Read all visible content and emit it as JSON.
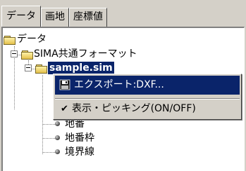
{
  "tabs": [
    {
      "label": "データ",
      "active": true
    },
    {
      "label": "画地",
      "active": false
    },
    {
      "label": "座標値",
      "active": false
    }
  ],
  "tree": {
    "root": {
      "label": "データ",
      "icon": "folder-icon"
    },
    "group": {
      "label": "SIMA共通フォーマット",
      "icon": "folder-icon"
    },
    "selected_item": {
      "label": "sample.sim",
      "icon": "folder-icon"
    },
    "children": [
      {
        "label": "地番",
        "icon": "bullet-icon"
      },
      {
        "label": "地番枠",
        "icon": "bullet-icon"
      },
      {
        "label": "境界線",
        "icon": "bullet-icon"
      }
    ]
  },
  "context_menu": {
    "items": [
      {
        "label": "エクスポート:DXF...",
        "icon": "floppy-disk-icon",
        "highlighted": true
      },
      {
        "label": "表示・ピッキング(ON/OFF)",
        "icon": "checkmark-icon",
        "checked": true
      }
    ]
  },
  "colors": {
    "face": "#d4d0c8",
    "highlight": "#0a246a",
    "highlight_text": "#ffffff"
  }
}
